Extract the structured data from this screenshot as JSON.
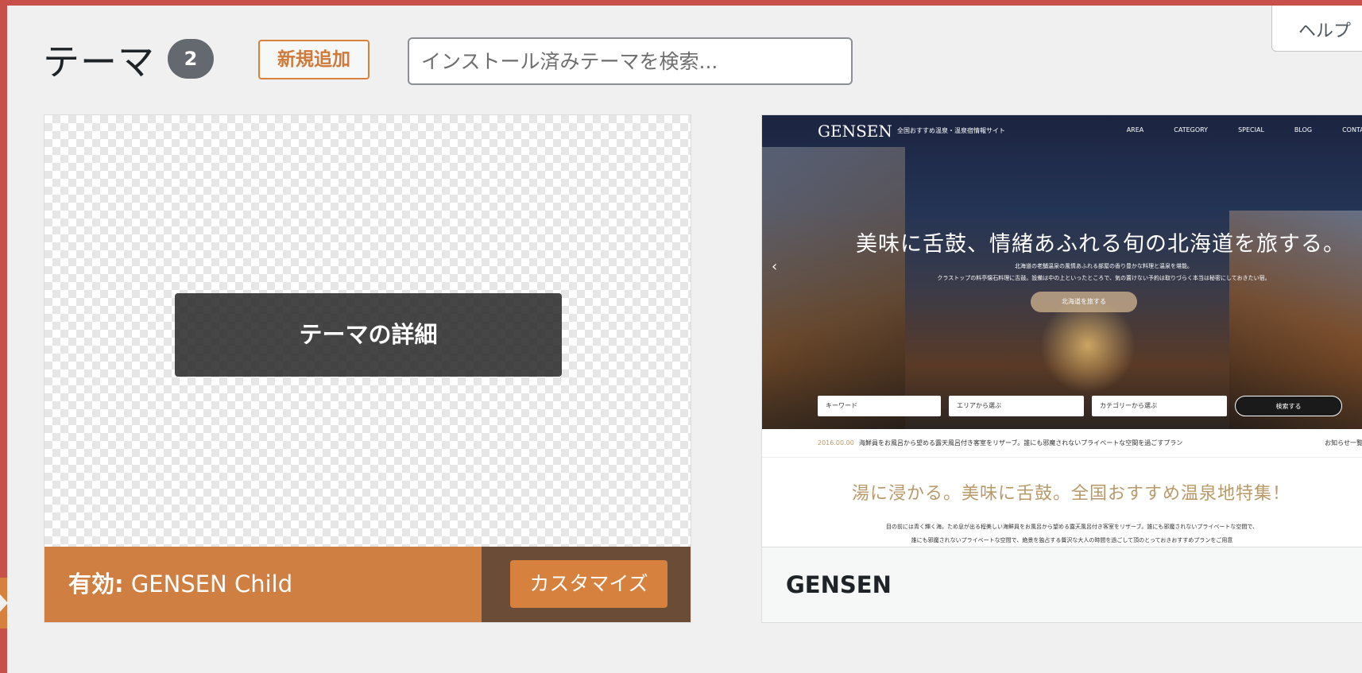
{
  "header": {
    "title": "テーマ",
    "count": "2",
    "add_new_label": "新規追加",
    "search_placeholder": "インストール済みテーマを検索...",
    "help_label": "ヘルプ"
  },
  "active_theme": {
    "details_label": "テーマの詳細",
    "active_label": "有効:",
    "name": "GENSEN Child",
    "customize_label": "カスタマイズ"
  },
  "gensen_theme": {
    "name": "GENSEN",
    "screenshot": {
      "logo": "GENSEN",
      "tagline": "全国おすすめ温泉・温泉宿情報サイト",
      "nav": [
        "AREA",
        "CATEGORY",
        "SPECIAL",
        "BLOG",
        "CONTACT"
      ],
      "headline": "美味に舌鼓、情緒あふれる旬の北海道を旅する。",
      "sub1": "北海道の老舗温泉の風情あふれる部屋の香り豊かな料理と温泉を堪能。",
      "sub2": "クラストップの料亭懐石料理に舌鼓。設備は中の上といったところで、気の置けない予約は取りづらく本当は秘密にしておきたい宿。",
      "cta": "北海道を旅する",
      "keyword": "キーワード",
      "area": "エリアから選ぶ",
      "category": "カテゴリーから選ぶ",
      "search": "検索する",
      "news_date": "2016.00.00",
      "news_text": "海鮮員をお風呂から望める露天風呂付き客室をリザーブ。誰にも邪魔されないプライベートな空間を過ごすプラン",
      "news_more": "お知らせ一覧",
      "feature_title": "湯に浸かる。美味に舌鼓。全国おすすめ温泉地特集！",
      "feature_text1": "目の前には青く輝く海。ため息が出る程美しい海鮮員をお風呂から望める露天風呂付き客室をリザーブ。誰にも邪魔されないプライベートな空間で、",
      "feature_text2": "誰にも邪魔されないプライベートな空間で、絶景を独占する贅沢な大人の時間を過ごして頂のとっておきおすすめプランをご用意"
    }
  },
  "colors": {
    "admin_bar": "#c9504a",
    "accent": "#d7813f",
    "active_footer": "#cf7f41",
    "active_footer_dark": "#6b4c37"
  }
}
